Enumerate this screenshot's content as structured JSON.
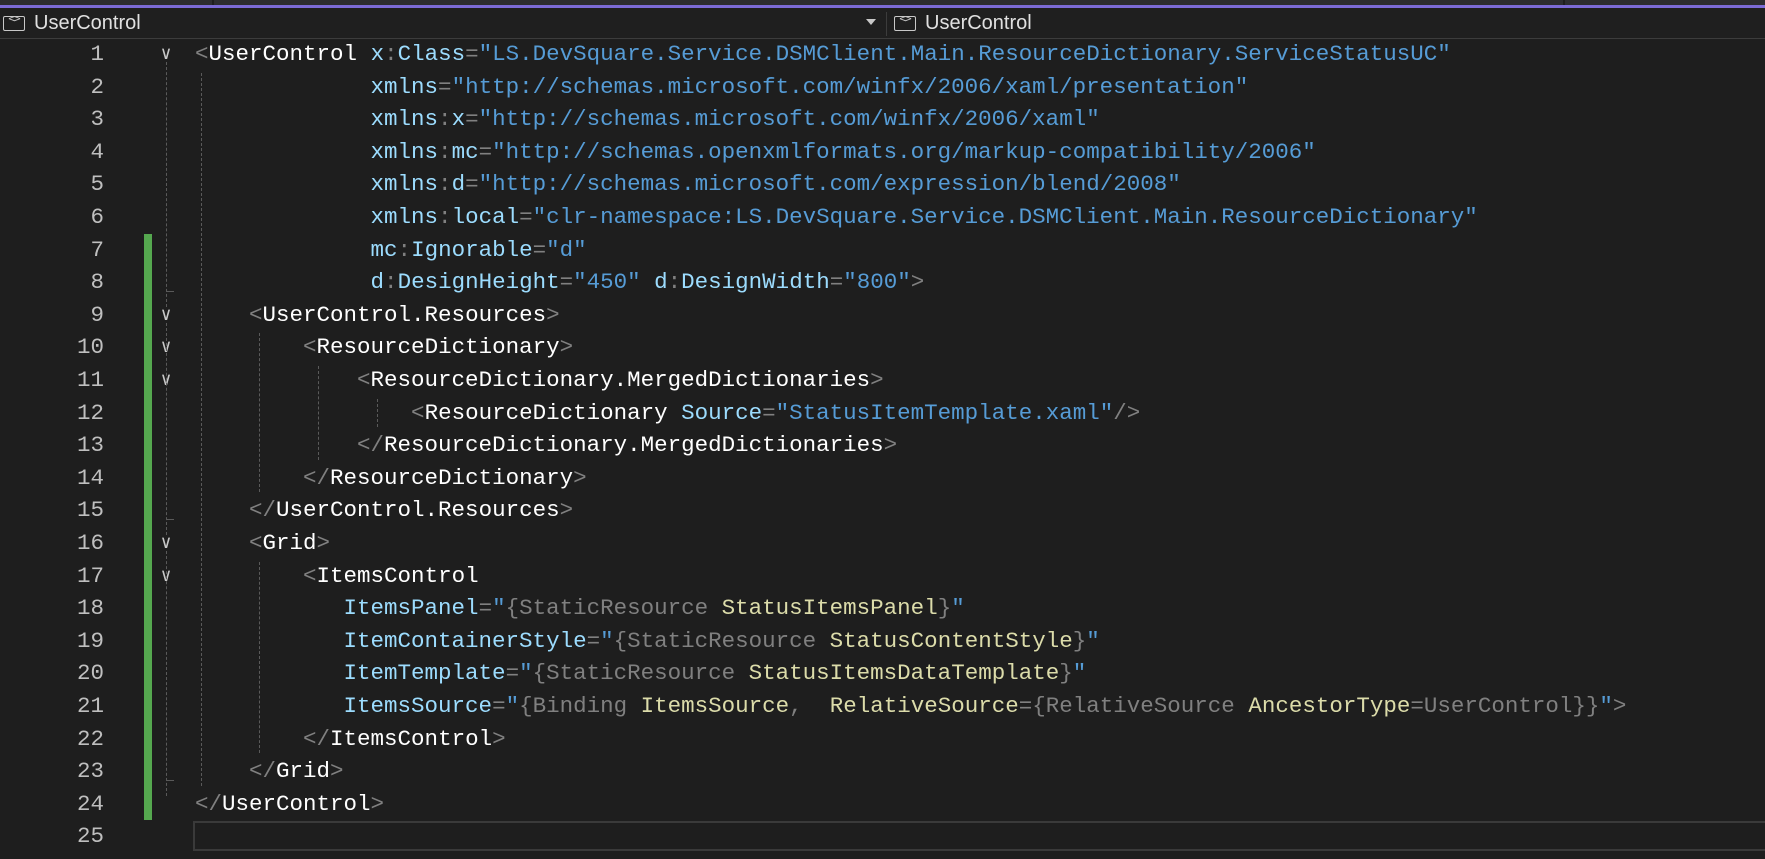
{
  "navbar": {
    "left_label": "UserControl",
    "right_label": "UserControl",
    "icon": "xaml-icon"
  },
  "editor": {
    "lines": [
      {
        "n": "1",
        "tokens": [
          [
            "d",
            "<"
          ],
          [
            "e",
            "UserControl"
          ],
          [
            "p",
            " "
          ],
          [
            "a",
            "x"
          ],
          [
            "d",
            ":"
          ],
          [
            "a",
            "Class"
          ],
          [
            "d",
            "="
          ],
          [
            "v",
            "\"LS.DevSquare.Service.DSMClient.Main.ResourceDictionary.ServiceStatusUC\""
          ]
        ]
      },
      {
        "n": "2",
        "tokens": [
          [
            "p",
            "             "
          ],
          [
            "a",
            "xmlns"
          ],
          [
            "d",
            "="
          ],
          [
            "v",
            "\"http://schemas.microsoft.com/winfx/2006/xaml/presentation\""
          ]
        ]
      },
      {
        "n": "3",
        "tokens": [
          [
            "p",
            "             "
          ],
          [
            "a",
            "xmlns"
          ],
          [
            "d",
            ":"
          ],
          [
            "a",
            "x"
          ],
          [
            "d",
            "="
          ],
          [
            "v",
            "\"http://schemas.microsoft.com/winfx/2006/xaml\""
          ]
        ]
      },
      {
        "n": "4",
        "tokens": [
          [
            "p",
            "             "
          ],
          [
            "a",
            "xmlns"
          ],
          [
            "d",
            ":"
          ],
          [
            "a",
            "mc"
          ],
          [
            "d",
            "="
          ],
          [
            "v",
            "\"http://schemas.openxmlformats.org/markup-compatibility/2006\""
          ]
        ]
      },
      {
        "n": "5",
        "tokens": [
          [
            "p",
            "             "
          ],
          [
            "a",
            "xmlns"
          ],
          [
            "d",
            ":"
          ],
          [
            "a",
            "d"
          ],
          [
            "d",
            "="
          ],
          [
            "v",
            "\"http://schemas.microsoft.com/expression/blend/2008\""
          ]
        ]
      },
      {
        "n": "6",
        "tokens": [
          [
            "p",
            "             "
          ],
          [
            "a",
            "xmlns"
          ],
          [
            "d",
            ":"
          ],
          [
            "a",
            "local"
          ],
          [
            "d",
            "="
          ],
          [
            "v",
            "\"clr-namespace:LS.DevSquare.Service.DSMClient.Main.ResourceDictionary\""
          ]
        ]
      },
      {
        "n": "7",
        "tokens": [
          [
            "p",
            "             "
          ],
          [
            "a",
            "mc"
          ],
          [
            "d",
            ":"
          ],
          [
            "a",
            "Ignorable"
          ],
          [
            "d",
            "="
          ],
          [
            "v",
            "\"d\""
          ]
        ]
      },
      {
        "n": "8",
        "tokens": [
          [
            "p",
            "             "
          ],
          [
            "a",
            "d"
          ],
          [
            "d",
            ":"
          ],
          [
            "a",
            "DesignHeight"
          ],
          [
            "d",
            "="
          ],
          [
            "v",
            "\"450\""
          ],
          [
            "p",
            " "
          ],
          [
            "a",
            "d"
          ],
          [
            "d",
            ":"
          ],
          [
            "a",
            "DesignWidth"
          ],
          [
            "d",
            "="
          ],
          [
            "v",
            "\"800\""
          ],
          [
            "d",
            ">"
          ]
        ]
      },
      {
        "n": "9",
        "tokens": [
          [
            "p",
            "    "
          ],
          [
            "d",
            "<"
          ],
          [
            "e",
            "UserControl.Resources"
          ],
          [
            "d",
            ">"
          ]
        ]
      },
      {
        "n": "10",
        "tokens": [
          [
            "p",
            "        "
          ],
          [
            "d",
            "<"
          ],
          [
            "e",
            "ResourceDictionary"
          ],
          [
            "d",
            ">"
          ]
        ]
      },
      {
        "n": "11",
        "tokens": [
          [
            "p",
            "            "
          ],
          [
            "d",
            "<"
          ],
          [
            "e",
            "ResourceDictionary.MergedDictionaries"
          ],
          [
            "d",
            ">"
          ]
        ]
      },
      {
        "n": "12",
        "tokens": [
          [
            "p",
            "                "
          ],
          [
            "d",
            "<"
          ],
          [
            "e",
            "ResourceDictionary"
          ],
          [
            "p",
            " "
          ],
          [
            "a",
            "Source"
          ],
          [
            "d",
            "="
          ],
          [
            "v",
            "\"StatusItemTemplate.xaml\""
          ],
          [
            "d",
            "/>"
          ]
        ]
      },
      {
        "n": "13",
        "tokens": [
          [
            "p",
            "            "
          ],
          [
            "d",
            "</"
          ],
          [
            "e",
            "ResourceDictionary.MergedDictionaries"
          ],
          [
            "d",
            ">"
          ]
        ]
      },
      {
        "n": "14",
        "tokens": [
          [
            "p",
            "        "
          ],
          [
            "d",
            "</"
          ],
          [
            "e",
            "ResourceDictionary"
          ],
          [
            "d",
            ">"
          ]
        ]
      },
      {
        "n": "15",
        "tokens": [
          [
            "p",
            "    "
          ],
          [
            "d",
            "</"
          ],
          [
            "e",
            "UserControl.Resources"
          ],
          [
            "d",
            ">"
          ]
        ]
      },
      {
        "n": "16",
        "tokens": [
          [
            "p",
            "    "
          ],
          [
            "d",
            "<"
          ],
          [
            "e",
            "Grid"
          ],
          [
            "d",
            ">"
          ]
        ]
      },
      {
        "n": "17",
        "tokens": [
          [
            "p",
            "        "
          ],
          [
            "d",
            "<"
          ],
          [
            "e",
            "ItemsControl"
          ]
        ]
      },
      {
        "n": "18",
        "tokens": [
          [
            "p",
            "           "
          ],
          [
            "a",
            "ItemsPanel"
          ],
          [
            "d",
            "="
          ],
          [
            "v",
            "\""
          ],
          [
            "d",
            "{"
          ],
          [
            "d",
            "StaticResource"
          ],
          [
            "p",
            " "
          ],
          [
            "y",
            "StatusItemsPanel"
          ],
          [
            "d",
            "}"
          ],
          [
            "v",
            "\""
          ]
        ]
      },
      {
        "n": "19",
        "tokens": [
          [
            "p",
            "           "
          ],
          [
            "a",
            "ItemContainerStyle"
          ],
          [
            "d",
            "="
          ],
          [
            "v",
            "\""
          ],
          [
            "d",
            "{"
          ],
          [
            "d",
            "StaticResource"
          ],
          [
            "p",
            " "
          ],
          [
            "y",
            "StatusContentStyle"
          ],
          [
            "d",
            "}"
          ],
          [
            "v",
            "\""
          ]
        ]
      },
      {
        "n": "20",
        "tokens": [
          [
            "p",
            "           "
          ],
          [
            "a",
            "ItemTemplate"
          ],
          [
            "d",
            "="
          ],
          [
            "v",
            "\""
          ],
          [
            "d",
            "{"
          ],
          [
            "d",
            "StaticResource"
          ],
          [
            "p",
            " "
          ],
          [
            "y",
            "StatusItemsDataTemplate"
          ],
          [
            "d",
            "}"
          ],
          [
            "v",
            "\""
          ]
        ]
      },
      {
        "n": "21",
        "tokens": [
          [
            "p",
            "           "
          ],
          [
            "a",
            "ItemsSource"
          ],
          [
            "d",
            "="
          ],
          [
            "v",
            "\""
          ],
          [
            "d",
            "{"
          ],
          [
            "d",
            "Binding"
          ],
          [
            "p",
            " "
          ],
          [
            "y",
            "ItemsSource"
          ],
          [
            "d",
            ","
          ],
          [
            "p",
            "  "
          ],
          [
            "y",
            "RelativeSource"
          ],
          [
            "d",
            "="
          ],
          [
            "d",
            "{"
          ],
          [
            "d",
            "RelativeSource"
          ],
          [
            "p",
            " "
          ],
          [
            "y",
            "AncestorType"
          ],
          [
            "d",
            "="
          ],
          [
            "d",
            "UserControl"
          ],
          [
            "d",
            "}}"
          ],
          [
            "v",
            "\""
          ],
          [
            "d",
            ">"
          ]
        ]
      },
      {
        "n": "22",
        "tokens": [
          [
            "p",
            "        "
          ],
          [
            "d",
            "</"
          ],
          [
            "e",
            "ItemsControl"
          ],
          [
            "d",
            ">"
          ]
        ]
      },
      {
        "n": "23",
        "tokens": [
          [
            "p",
            "    "
          ],
          [
            "d",
            "</"
          ],
          [
            "e",
            "Grid"
          ],
          [
            "d",
            ">"
          ]
        ]
      },
      {
        "n": "24",
        "tokens": [
          [
            "d",
            "</"
          ],
          [
            "e",
            "UserControl"
          ],
          [
            "d",
            ">"
          ]
        ]
      },
      {
        "n": "25",
        "tokens": []
      }
    ],
    "changed_lines": [
      "7",
      "8",
      "9",
      "10",
      "11",
      "12",
      "13",
      "14",
      "15",
      "16",
      "17",
      "18",
      "19",
      "20",
      "21",
      "22",
      "23",
      "24"
    ],
    "fold_lines": [
      "1",
      "9",
      "10",
      "11",
      "16",
      "17"
    ]
  }
}
